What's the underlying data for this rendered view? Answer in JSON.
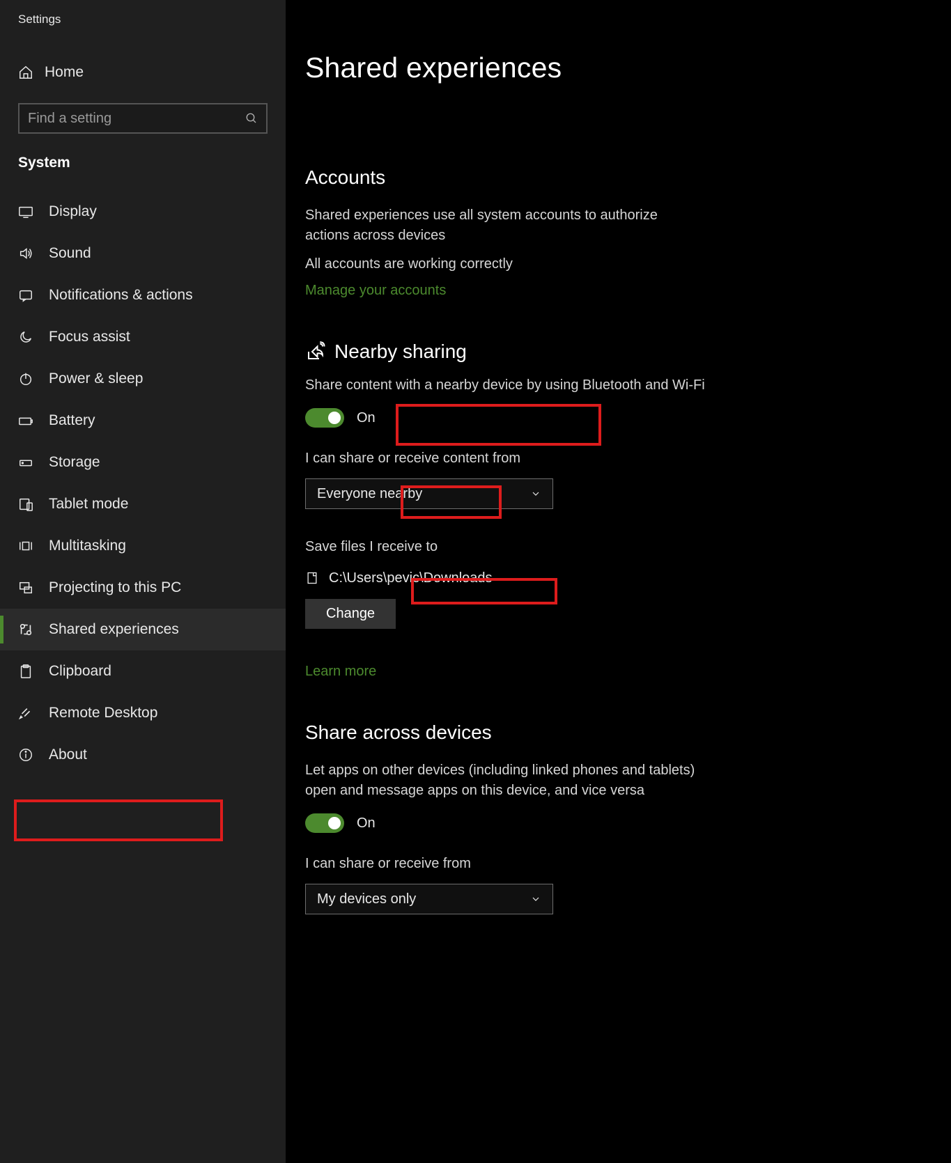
{
  "app_title": "Settings",
  "home_label": "Home",
  "search": {
    "placeholder": "Find a setting"
  },
  "category": "System",
  "nav": [
    {
      "id": "display",
      "label": "Display"
    },
    {
      "id": "sound",
      "label": "Sound"
    },
    {
      "id": "notifications",
      "label": "Notifications & actions"
    },
    {
      "id": "focus-assist",
      "label": "Focus assist"
    },
    {
      "id": "power-sleep",
      "label": "Power & sleep"
    },
    {
      "id": "battery",
      "label": "Battery"
    },
    {
      "id": "storage",
      "label": "Storage"
    },
    {
      "id": "tablet-mode",
      "label": "Tablet mode"
    },
    {
      "id": "multitasking",
      "label": "Multitasking"
    },
    {
      "id": "projecting",
      "label": "Projecting to this PC"
    },
    {
      "id": "shared-experiences",
      "label": "Shared experiences",
      "selected": true
    },
    {
      "id": "clipboard",
      "label": "Clipboard"
    },
    {
      "id": "remote-desktop",
      "label": "Remote Desktop"
    },
    {
      "id": "about",
      "label": "About"
    }
  ],
  "page_title": "Shared experiences",
  "accounts": {
    "heading": "Accounts",
    "desc": "Shared experiences use all system accounts to authorize actions across devices",
    "status": "All accounts are working correctly",
    "manage_link": "Manage your accounts"
  },
  "nearby": {
    "heading": "Nearby sharing",
    "desc": "Share content with a nearby device by using Bluetooth and Wi-Fi",
    "toggle_label": "On",
    "share_from_label": "I can share or receive content from",
    "share_from_value": "Everyone nearby",
    "save_to_label": "Save files I receive to",
    "save_to_path": "C:\\Users\\pevic\\Downloads",
    "change_button": "Change",
    "learn_more": "Learn more"
  },
  "across": {
    "heading": "Share across devices",
    "desc": "Let apps on other devices (including linked phones and tablets) open and message apps on this device, and vice versa",
    "toggle_label": "On",
    "share_from_label": "I can share or receive from",
    "share_from_value": "My devices only"
  }
}
